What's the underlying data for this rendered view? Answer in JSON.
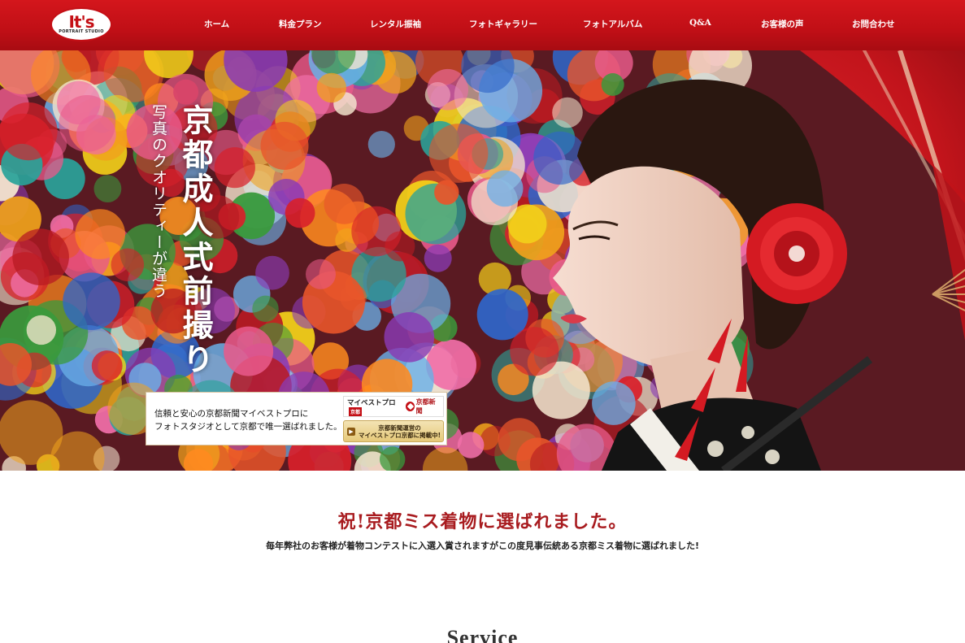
{
  "header": {
    "logo_main": "It's",
    "logo_sub": "PORTRAIT STUDIO",
    "brand_color": "#c40f15"
  },
  "nav": {
    "items": [
      {
        "label": "ホーム"
      },
      {
        "label": "料金プラン"
      },
      {
        "label": "レンタル振袖"
      },
      {
        "label": "フォトギャラリー"
      },
      {
        "label": "フォトアルバム"
      },
      {
        "label": "Q&A"
      },
      {
        "label": "お客様の声"
      },
      {
        "label": "お問合わせ"
      }
    ]
  },
  "hero": {
    "title": "京都成人式前撮り",
    "subtitle": "写真のクオリティーが違う",
    "badge": {
      "line1": "信頼と安心の京都新聞マイベストプロに",
      "line2": "フォトスタジオとして京都で唯一選ばれました。",
      "logo_mbp": "マイベストプロ",
      "logo_mbp_tag": "京都",
      "logo_kyoto": "京都新聞",
      "button_line1": "京都新聞運営の",
      "button_line2": "マイベストプロ京都に掲載中!"
    }
  },
  "main": {
    "headline": "祝!京都ミス着物に選ばれました。",
    "text": "毎年弊社のお客様が着物コンテストに入選入賞されますがこの度見事伝統ある京都ミス着物に選ばれました!",
    "headline_color": "#a81b1f",
    "service_heading": "Service"
  }
}
